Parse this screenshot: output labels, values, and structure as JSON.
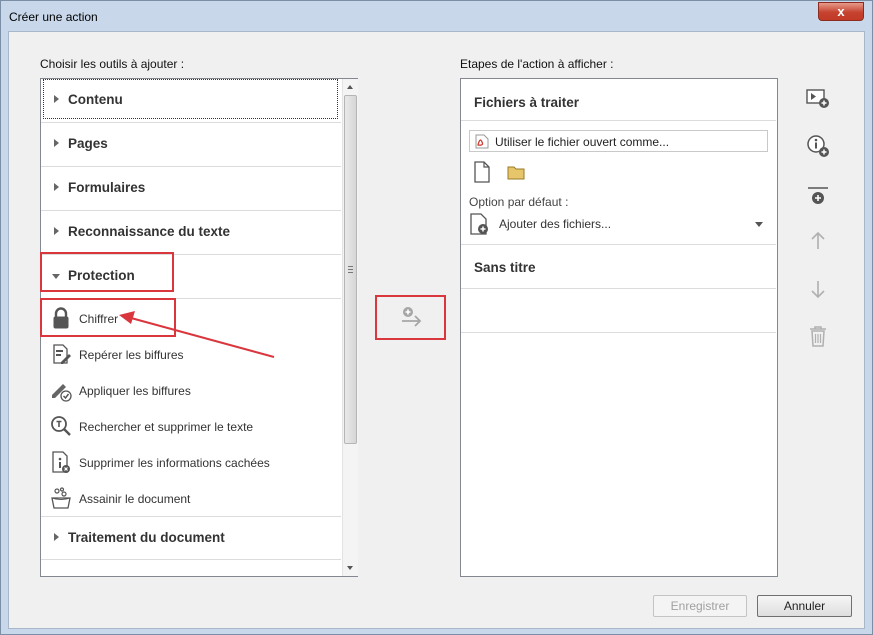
{
  "window": {
    "title": "Créer une action",
    "close_glyph": "x"
  },
  "left": {
    "heading": "Choisir les outils à ajouter :",
    "categories": [
      {
        "label": "Contenu",
        "expanded": false
      },
      {
        "label": "Pages",
        "expanded": false
      },
      {
        "label": "Formulaires",
        "expanded": false
      },
      {
        "label": "Reconnaissance du texte",
        "expanded": false
      },
      {
        "label": "Protection",
        "expanded": true
      },
      {
        "label": "Traitement du document",
        "expanded": false
      }
    ],
    "protection_tools": [
      {
        "label": "Chiffrer",
        "icon": "lock-icon"
      },
      {
        "label": "Repérer les biffures",
        "icon": "mark-redaction-icon"
      },
      {
        "label": "Appliquer les biffures",
        "icon": "apply-redaction-icon"
      },
      {
        "label": "Rechercher et supprimer le texte",
        "icon": "search-remove-text-icon"
      },
      {
        "label": "Supprimer les informations cachées",
        "icon": "remove-hidden-info-icon"
      },
      {
        "label": "Assainir le document",
        "icon": "sanitize-icon"
      }
    ]
  },
  "middle": {
    "add_icon": "add-to-action-icon"
  },
  "right": {
    "heading": "Etapes de l'action à afficher :",
    "files_section_title": "Fichiers à traiter",
    "file_field_value": "Utiliser le fichier ouvert comme...",
    "default_option_label": "Option par défaut :",
    "add_files_value": "Ajouter des fichiers...",
    "untitled_section": "Sans titre"
  },
  "side_tools": [
    {
      "name": "add-panel-icon"
    },
    {
      "name": "add-instructions-icon"
    },
    {
      "name": "add-separator-icon"
    },
    {
      "name": "move-up-icon"
    },
    {
      "name": "move-down-icon"
    },
    {
      "name": "delete-icon"
    }
  ],
  "footer": {
    "save_label": "Enregistrer",
    "cancel_label": "Annuler"
  },
  "colors": {
    "annotation_red": "#d9363e",
    "window_frame": "#c8d8ea"
  }
}
